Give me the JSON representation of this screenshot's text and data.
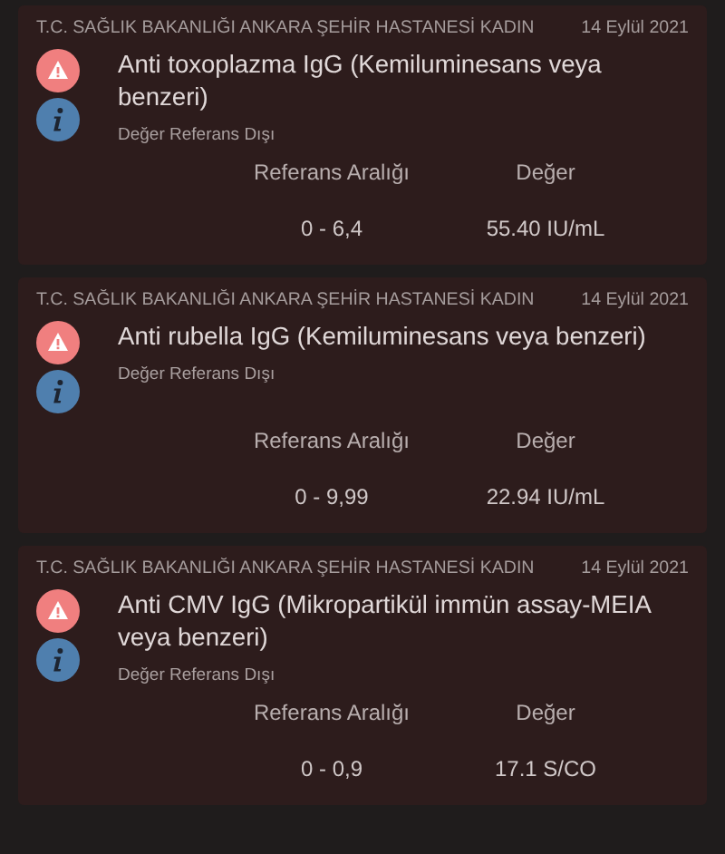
{
  "results": [
    {
      "source": "T.C. SAĞLIK BAKANLIĞI ANKARA ŞEHİR HASTANESİ KADIN",
      "date": "14 Eylül 2021",
      "title": "Anti toxoplazma IgG (Kemiluminesans veya benzeri)",
      "status": "Değer Referans Dışı",
      "columns": [
        "Referans Aralığı",
        "Değer"
      ],
      "values": [
        "0 - 6,4",
        "55.40 IU/mL"
      ]
    },
    {
      "source": "T.C. SAĞLIK BAKANLIĞI ANKARA ŞEHİR HASTANESİ KADIN",
      "date": "14 Eylül 2021",
      "title": "Anti rubella IgG (Kemiluminesans veya benzeri)",
      "status": "Değer Referans Dışı",
      "columns": [
        "Referans Aralığı",
        "Değer"
      ],
      "values": [
        "0 - 9,99",
        "22.94 IU/mL"
      ]
    },
    {
      "source": "T.C. SAĞLIK BAKANLIĞI ANKARA ŞEHİR HASTANESİ KADIN",
      "date": "14 Eylül 2021",
      "title": "Anti CMV IgG (Mikropartikül immün assay-MEIA veya benzeri)",
      "status": "Değer Referans Dışı",
      "columns": [
        "Referans Aralığı",
        "Değer"
      ],
      "values": [
        "0 - 0,9",
        "17.1 S/CO"
      ]
    }
  ]
}
